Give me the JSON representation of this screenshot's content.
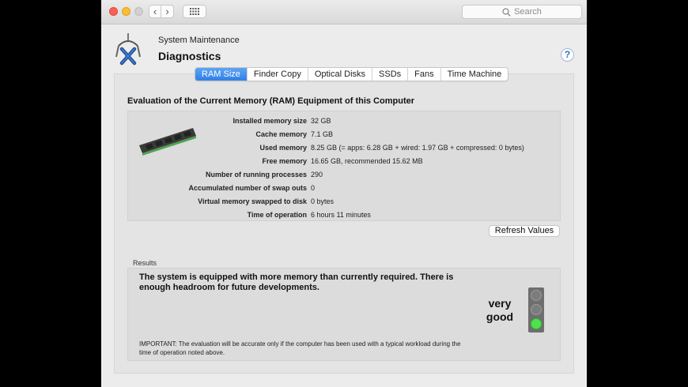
{
  "window": {
    "search_placeholder": "Search",
    "nav_back_glyph": "‹",
    "nav_forward_glyph": "›"
  },
  "header": {
    "supertitle": "System Maintenance",
    "title": "Diagnostics",
    "help_glyph": "?"
  },
  "tabs": [
    {
      "label": "RAM Size",
      "active": true
    },
    {
      "label": "Finder Copy",
      "active": false
    },
    {
      "label": "Optical Disks",
      "active": false
    },
    {
      "label": "SSDs",
      "active": false
    },
    {
      "label": "Fans",
      "active": false
    },
    {
      "label": "Time Machine",
      "active": false
    }
  ],
  "evaluation": {
    "title": "Evaluation of the Current Memory (RAM) Equipment of this Computer",
    "rows": [
      {
        "label": "Installed memory size",
        "value": "32 GB"
      },
      {
        "label": "Cache memory",
        "value": "7.1 GB"
      },
      {
        "label": "Used memory",
        "value": "8.25 GB (= apps: 6.28 GB + wired: 1.97 GB + compressed: 0 bytes)"
      },
      {
        "label": "Free memory",
        "value": "16.65 GB, recommended 15.62 MB"
      },
      {
        "label": "Number of running processes",
        "value": "290"
      },
      {
        "label": "Accumulated number of swap outs",
        "value": "0"
      },
      {
        "label": "Virtual memory swapped to disk",
        "value": "0 bytes"
      },
      {
        "label": "Time of operation",
        "value": "6 hours 11 minutes"
      }
    ],
    "refresh_label": "Refresh Values"
  },
  "results": {
    "label": "Results",
    "message": "The system is equipped with more memory than currently required. There is enough headroom for future developments.",
    "rating_line1": "very",
    "rating_line2": "good",
    "traffic_light_state": "green",
    "important_note": "IMPORTANT: The evaluation will be accurate only if the computer has been used with a typical workload during the time of operation noted above."
  },
  "colors": {
    "accent": "#2f7fe6",
    "good": "#4ee34e"
  }
}
